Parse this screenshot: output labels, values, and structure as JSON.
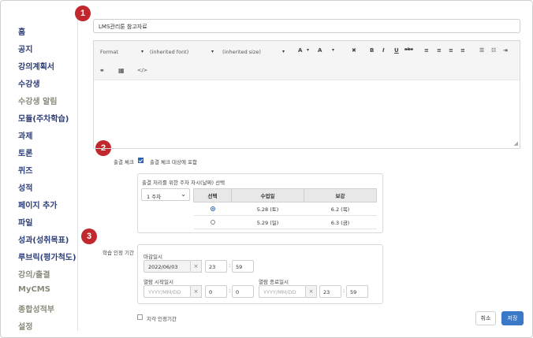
{
  "sidebar": {
    "items": [
      {
        "label": "홈",
        "muted": false
      },
      {
        "label": "공지",
        "muted": false
      },
      {
        "label": "강의계획서",
        "muted": false
      },
      {
        "label": "수강생",
        "muted": false
      },
      {
        "label": "수강생 알림",
        "muted": true
      },
      {
        "label": "모듈(주차학습)",
        "muted": false
      },
      {
        "label": "과제",
        "muted": false
      },
      {
        "label": "토론",
        "muted": false
      },
      {
        "label": "퀴즈",
        "muted": false
      },
      {
        "label": "성적",
        "muted": false
      },
      {
        "label": "페이지 추가",
        "muted": false
      },
      {
        "label": "파일",
        "muted": false
      },
      {
        "label": "성과(성취목표)",
        "muted": false
      },
      {
        "label": "루브릭(평가척도)",
        "muted": false
      },
      {
        "label": "강의/출결",
        "muted": true
      },
      {
        "label": "MyCMS",
        "muted": true
      },
      {
        "label": "종합성적부",
        "muted": true
      },
      {
        "label": "설정",
        "muted": true
      }
    ]
  },
  "badges": [
    "1",
    "2",
    "3"
  ],
  "title_value": "LMS관리툰 참고자료",
  "toolbar": {
    "format": "Format",
    "font": "(inherited font)",
    "size": "(inherited size)",
    "caret": "▾",
    "font_color": "A",
    "bg_color": "A",
    "clear": "✖",
    "bold": "B",
    "italic": "I",
    "underline": "U",
    "strike": "abc",
    "align_left": "≡",
    "align_center": "≡",
    "align_right": "≡",
    "justify": "≡",
    "bullet_list": "☰",
    "numbered_list": "☷",
    "indent": "⇥",
    "link": "⚭",
    "table": "▦",
    "source": "</>",
    "resize": "◢"
  },
  "attendance": {
    "label": "출결 체크",
    "checkbox_label": "출결 체크 대상에 포함",
    "checked": true,
    "week_section_label": "출결 처리를 위한 주차 차시(날짜) 선택",
    "week_select": "1 주차",
    "week_caret": "⌄",
    "table": {
      "headers": [
        "선택",
        "수업일",
        "보강"
      ],
      "rows": [
        {
          "selected": true,
          "date": "5.28 (토)",
          "makeup": "6.2 (목)"
        },
        {
          "selected": false,
          "date": "5.29 (일)",
          "makeup": "6.3 (금)"
        }
      ]
    }
  },
  "period": {
    "label": "학습 인정 기간",
    "deadline_label": "마감일시",
    "deadline_date": "2022/06/03",
    "deadline_hour": "23",
    "deadline_minute": "59",
    "open_start_label": "열람 시작일시",
    "open_start_placeholder": "YYYY/MM/DD",
    "open_start_hour": "0",
    "open_start_minute": "0",
    "open_end_label": "열람 종료일시",
    "open_end_placeholder": "YYYY/MM/DD",
    "open_end_hour": "23",
    "open_end_minute": "59",
    "clear": "×",
    "colon": ":"
  },
  "late_label": "지각 인정기간",
  "buttons": {
    "cancel": "취소",
    "save": "저장"
  },
  "colors": {
    "accent": "#3a78c8",
    "badge": "#c0282d",
    "nav": "#2c3e78"
  }
}
